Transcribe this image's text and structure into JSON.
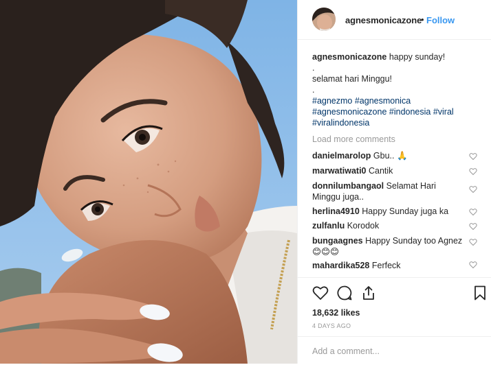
{
  "header": {
    "username": "agnesmonicazone",
    "separator": "•",
    "follow_label": "Follow"
  },
  "caption": {
    "username": "agnesmonicazone",
    "line1": "happy sunday!",
    "dot1": ".",
    "line2": "selamat hari Minggu!",
    "dot2": ".",
    "hashtags_line1": "#agnezmo #agnesmonica",
    "hashtags_line2": "#agnesmonicazone #indonesia #viral",
    "hashtags_line3": "#viralindonesia"
  },
  "load_more_label": "Load more comments",
  "comments": [
    {
      "user": "danielmarolop",
      "text": "Gbu.. 🙏"
    },
    {
      "user": "marwatiwati0",
      "text": "Cantik"
    },
    {
      "user": "donnilumbangaol",
      "text": "Selamat Hari",
      "text2": "Minggu juga.."
    },
    {
      "user": "herlina4910",
      "text": "Happy Sunday juga ka"
    },
    {
      "user": "zulfanlu",
      "text": "Korodok"
    },
    {
      "user": "bungaagnes",
      "text": "Happy Sunday too Agnez",
      "text2": "😊😊😊"
    },
    {
      "user": "mahardika528",
      "text": "Ferfeck"
    }
  ],
  "actions": {
    "likes": "18,632 likes",
    "timestamp": "4 DAYS AGO",
    "add_comment_placeholder": "Add a comment..."
  },
  "icons": [
    "heart-icon",
    "comment-icon",
    "share-icon",
    "bookmark-icon"
  ]
}
